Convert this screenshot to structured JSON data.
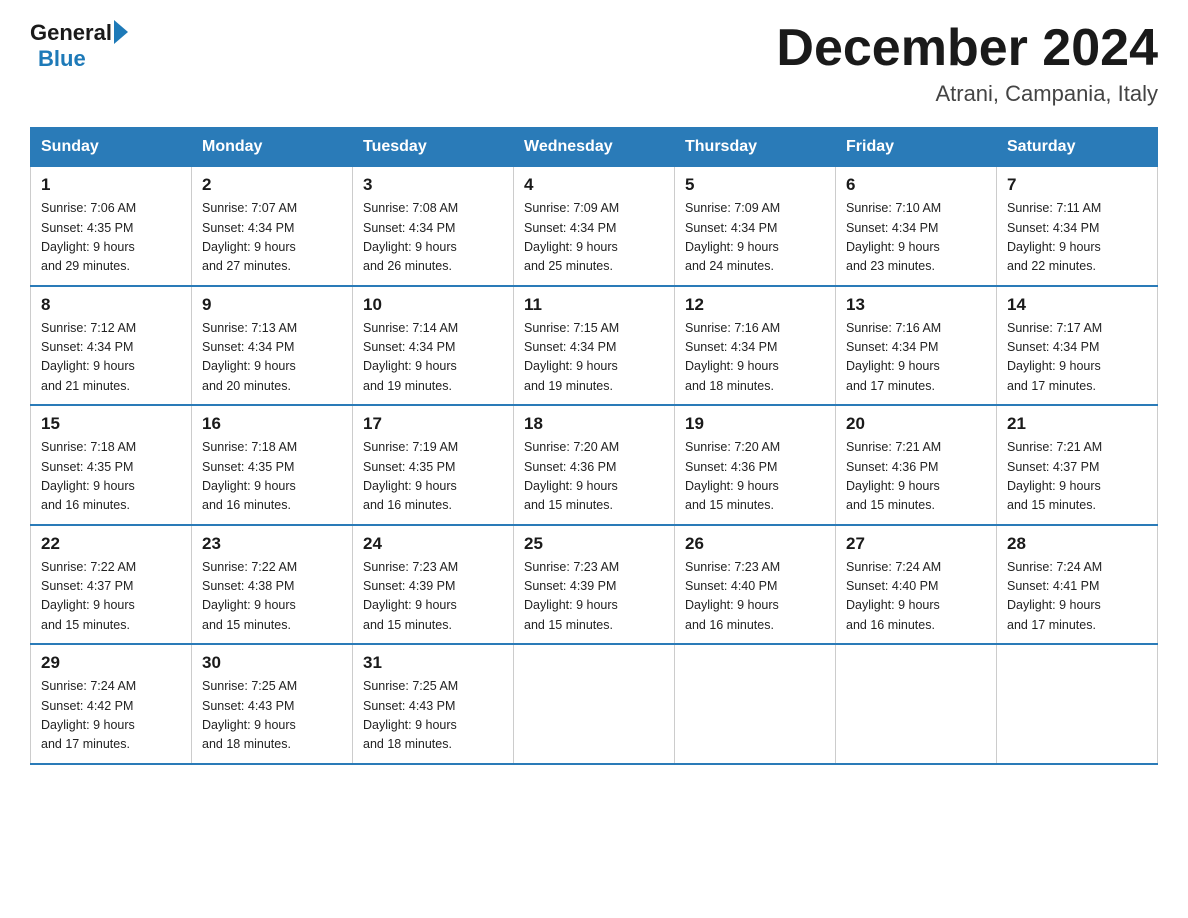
{
  "header": {
    "logo_general": "General",
    "logo_blue": "Blue",
    "title": "December 2024",
    "location": "Atrani, Campania, Italy"
  },
  "days_of_week": [
    "Sunday",
    "Monday",
    "Tuesday",
    "Wednesday",
    "Thursday",
    "Friday",
    "Saturday"
  ],
  "weeks": [
    [
      {
        "num": "1",
        "sunrise": "7:06 AM",
        "sunset": "4:35 PM",
        "daylight": "9 hours and 29 minutes."
      },
      {
        "num": "2",
        "sunrise": "7:07 AM",
        "sunset": "4:34 PM",
        "daylight": "9 hours and 27 minutes."
      },
      {
        "num": "3",
        "sunrise": "7:08 AM",
        "sunset": "4:34 PM",
        "daylight": "9 hours and 26 minutes."
      },
      {
        "num": "4",
        "sunrise": "7:09 AM",
        "sunset": "4:34 PM",
        "daylight": "9 hours and 25 minutes."
      },
      {
        "num": "5",
        "sunrise": "7:09 AM",
        "sunset": "4:34 PM",
        "daylight": "9 hours and 24 minutes."
      },
      {
        "num": "6",
        "sunrise": "7:10 AM",
        "sunset": "4:34 PM",
        "daylight": "9 hours and 23 minutes."
      },
      {
        "num": "7",
        "sunrise": "7:11 AM",
        "sunset": "4:34 PM",
        "daylight": "9 hours and 22 minutes."
      }
    ],
    [
      {
        "num": "8",
        "sunrise": "7:12 AM",
        "sunset": "4:34 PM",
        "daylight": "9 hours and 21 minutes."
      },
      {
        "num": "9",
        "sunrise": "7:13 AM",
        "sunset": "4:34 PM",
        "daylight": "9 hours and 20 minutes."
      },
      {
        "num": "10",
        "sunrise": "7:14 AM",
        "sunset": "4:34 PM",
        "daylight": "9 hours and 19 minutes."
      },
      {
        "num": "11",
        "sunrise": "7:15 AM",
        "sunset": "4:34 PM",
        "daylight": "9 hours and 19 minutes."
      },
      {
        "num": "12",
        "sunrise": "7:16 AM",
        "sunset": "4:34 PM",
        "daylight": "9 hours and 18 minutes."
      },
      {
        "num": "13",
        "sunrise": "7:16 AM",
        "sunset": "4:34 PM",
        "daylight": "9 hours and 17 minutes."
      },
      {
        "num": "14",
        "sunrise": "7:17 AM",
        "sunset": "4:34 PM",
        "daylight": "9 hours and 17 minutes."
      }
    ],
    [
      {
        "num": "15",
        "sunrise": "7:18 AM",
        "sunset": "4:35 PM",
        "daylight": "9 hours and 16 minutes."
      },
      {
        "num": "16",
        "sunrise": "7:18 AM",
        "sunset": "4:35 PM",
        "daylight": "9 hours and 16 minutes."
      },
      {
        "num": "17",
        "sunrise": "7:19 AM",
        "sunset": "4:35 PM",
        "daylight": "9 hours and 16 minutes."
      },
      {
        "num": "18",
        "sunrise": "7:20 AM",
        "sunset": "4:36 PM",
        "daylight": "9 hours and 15 minutes."
      },
      {
        "num": "19",
        "sunrise": "7:20 AM",
        "sunset": "4:36 PM",
        "daylight": "9 hours and 15 minutes."
      },
      {
        "num": "20",
        "sunrise": "7:21 AM",
        "sunset": "4:36 PM",
        "daylight": "9 hours and 15 minutes."
      },
      {
        "num": "21",
        "sunrise": "7:21 AM",
        "sunset": "4:37 PM",
        "daylight": "9 hours and 15 minutes."
      }
    ],
    [
      {
        "num": "22",
        "sunrise": "7:22 AM",
        "sunset": "4:37 PM",
        "daylight": "9 hours and 15 minutes."
      },
      {
        "num": "23",
        "sunrise": "7:22 AM",
        "sunset": "4:38 PM",
        "daylight": "9 hours and 15 minutes."
      },
      {
        "num": "24",
        "sunrise": "7:23 AM",
        "sunset": "4:39 PM",
        "daylight": "9 hours and 15 minutes."
      },
      {
        "num": "25",
        "sunrise": "7:23 AM",
        "sunset": "4:39 PM",
        "daylight": "9 hours and 15 minutes."
      },
      {
        "num": "26",
        "sunrise": "7:23 AM",
        "sunset": "4:40 PM",
        "daylight": "9 hours and 16 minutes."
      },
      {
        "num": "27",
        "sunrise": "7:24 AM",
        "sunset": "4:40 PM",
        "daylight": "9 hours and 16 minutes."
      },
      {
        "num": "28",
        "sunrise": "7:24 AM",
        "sunset": "4:41 PM",
        "daylight": "9 hours and 17 minutes."
      }
    ],
    [
      {
        "num": "29",
        "sunrise": "7:24 AM",
        "sunset": "4:42 PM",
        "daylight": "9 hours and 17 minutes."
      },
      {
        "num": "30",
        "sunrise": "7:25 AM",
        "sunset": "4:43 PM",
        "daylight": "9 hours and 18 minutes."
      },
      {
        "num": "31",
        "sunrise": "7:25 AM",
        "sunset": "4:43 PM",
        "daylight": "9 hours and 18 minutes."
      },
      null,
      null,
      null,
      null
    ]
  ]
}
